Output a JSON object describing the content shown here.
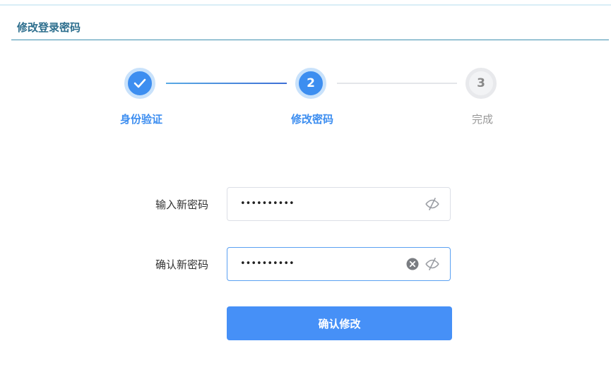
{
  "page": {
    "title": "修改登录密码"
  },
  "stepper": {
    "steps": [
      {
        "label": "身份验证",
        "number": "1",
        "state": "done"
      },
      {
        "label": "修改密码",
        "number": "2",
        "state": "active"
      },
      {
        "label": "完成",
        "number": "3",
        "state": "pending"
      }
    ]
  },
  "form": {
    "new_password": {
      "label": "输入新密码",
      "value": "••••••••••"
    },
    "confirm_password": {
      "label": "确认新密码",
      "value": "••••••••••"
    },
    "submit_label": "确认修改"
  },
  "colors": {
    "primary": "#3d8ef0",
    "title": "#2e6f8e",
    "pending": "#999999"
  },
  "icons": {
    "done_step": "check-icon",
    "toggle_visibility": "eye-off-icon",
    "clear": "clear-icon"
  }
}
